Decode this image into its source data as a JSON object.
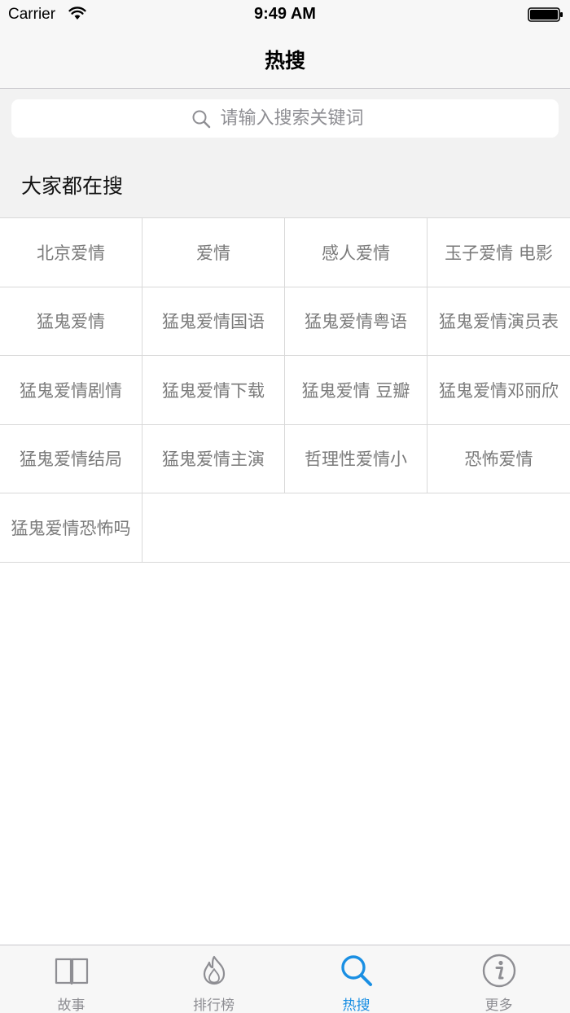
{
  "status_bar": {
    "carrier": "Carrier",
    "time": "9:49 AM"
  },
  "nav": {
    "title": "热搜"
  },
  "search": {
    "placeholder": "请输入搜索关键词"
  },
  "section": {
    "title": "大家都在搜"
  },
  "tags": [
    [
      "北京爱情",
      "爱情",
      "感人爱情",
      "玉子爱情 电影"
    ],
    [
      "猛鬼爱情",
      "猛鬼爱情国语",
      "猛鬼爱情粤语",
      "猛鬼爱情演员表"
    ],
    [
      "猛鬼爱情剧情",
      "猛鬼爱情下载",
      "猛鬼爱情 豆瓣",
      "猛鬼爱情邓丽欣"
    ],
    [
      "猛鬼爱情结局",
      "猛鬼爱情主演",
      "哲理性爱情小",
      "恐怖爱情"
    ],
    [
      "猛鬼爱情恐怖吗"
    ]
  ],
  "tab_bar": {
    "accent_color": "#1a8fe3",
    "inactive_color": "#8e8e93",
    "items": [
      {
        "label": "故事",
        "icon": "book-icon",
        "active": false
      },
      {
        "label": "排行榜",
        "icon": "flame-icon",
        "active": false
      },
      {
        "label": "热搜",
        "icon": "search-icon",
        "active": true
      },
      {
        "label": "更多",
        "icon": "info-icon",
        "active": false
      }
    ]
  }
}
